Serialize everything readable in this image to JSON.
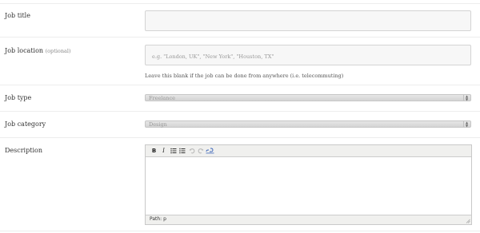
{
  "fields": {
    "job_title": {
      "label": "Job title",
      "value": ""
    },
    "job_location": {
      "label": "Job location",
      "optional": "(optional)",
      "placeholder": "e.g. \"London, UK\", \"New York\", \"Houston, TX\"",
      "hint": "Leave this blank if the job can be done from anywhere (i.e. telecommuting)"
    },
    "job_type": {
      "label": "Job type",
      "selected": "Freelance"
    },
    "job_category": {
      "label": "Job category",
      "selected": "Design"
    },
    "description": {
      "label": "Description",
      "toolbar": {
        "bold": "B",
        "italic": "I",
        "bullet_list_icon": "bullet-list-icon",
        "numbered_list_icon": "numbered-list-icon",
        "undo_icon": "undo-icon",
        "redo_icon": "redo-icon",
        "link_icon": "link-icon"
      },
      "path": "Path: p"
    }
  }
}
